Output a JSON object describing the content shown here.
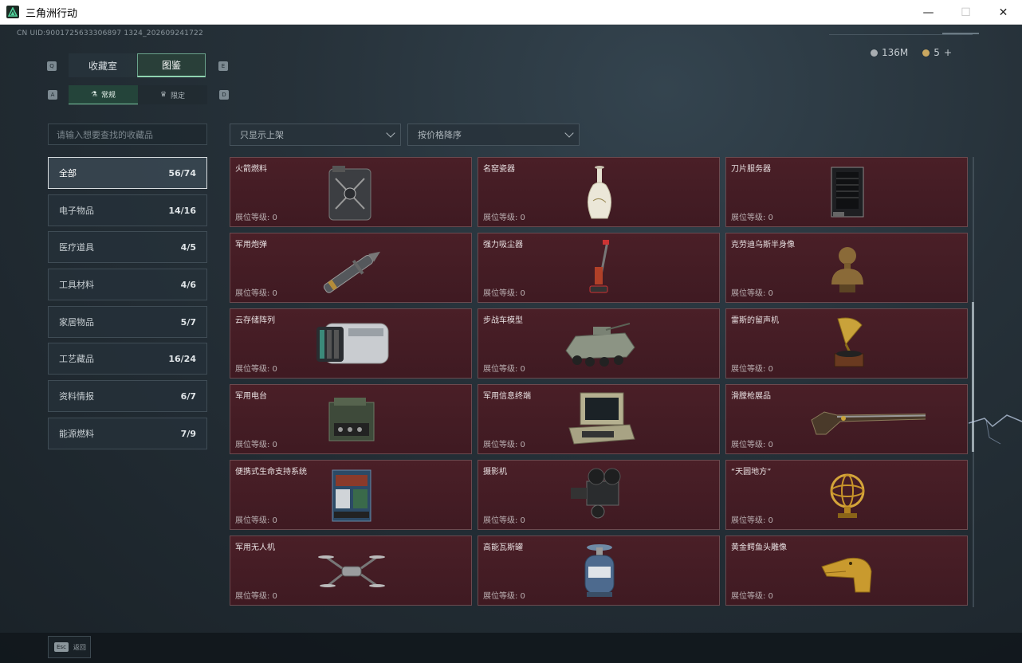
{
  "window": {
    "title": "三角洲行动",
    "minimize": "—",
    "maximize": "☐",
    "close": "✕"
  },
  "header": {
    "uid": "CN UID:9001725633306897 1324_202609241722",
    "currency_a": "136M",
    "currency_b": "5",
    "currency_add": "+"
  },
  "tabs": {
    "left_key": "Q",
    "right_key": "E",
    "primary": [
      {
        "label": "收藏室"
      },
      {
        "label": "图鉴"
      }
    ],
    "sub_left_key": "A",
    "sub_right_key": "D",
    "secondary": [
      {
        "label": "常规",
        "icon": "flask-icon"
      },
      {
        "label": "限定",
        "icon": "crown-icon"
      }
    ]
  },
  "search": {
    "placeholder": "请输入想要查找的收藏品"
  },
  "filters": {
    "display": "只显示上架",
    "sort": "按价格降序"
  },
  "categories": [
    {
      "label": "全部",
      "count": "56/74"
    },
    {
      "label": "电子物品",
      "count": "14/16"
    },
    {
      "label": "医疗道具",
      "count": "4/5"
    },
    {
      "label": "工具材料",
      "count": "4/6"
    },
    {
      "label": "家居物品",
      "count": "5/7"
    },
    {
      "label": "工艺藏品",
      "count": "16/24"
    },
    {
      "label": "资料情报",
      "count": "6/7"
    },
    {
      "label": "能源燃料",
      "count": "7/9"
    }
  ],
  "items": [
    {
      "name": "火箭燃料",
      "level": "展位等级: 0",
      "icon": "fuel-jerrycan-icon"
    },
    {
      "name": "名窑瓷器",
      "level": "展位等级: 0",
      "icon": "porcelain-vase-icon"
    },
    {
      "name": "刀片服务器",
      "level": "展位等级: 0",
      "icon": "blade-server-icon"
    },
    {
      "name": "军用炮弹",
      "level": "展位等级: 0",
      "icon": "artillery-shell-icon"
    },
    {
      "name": "强力吸尘器",
      "level": "展位等级: 0",
      "icon": "vacuum-cleaner-icon"
    },
    {
      "name": "克劳迪乌斯半身像",
      "level": "展位等级: 0",
      "icon": "bust-statue-icon"
    },
    {
      "name": "云存储阵列",
      "level": "展位等级: 0",
      "icon": "storage-array-icon"
    },
    {
      "name": "步战车模型",
      "level": "展位等级: 0",
      "icon": "ifv-model-icon"
    },
    {
      "name": "雷斯的留声机",
      "level": "展位等级: 0",
      "icon": "gramophone-icon"
    },
    {
      "name": "军用电台",
      "level": "展位等级: 0",
      "icon": "military-radio-icon"
    },
    {
      "name": "军用信息终端",
      "level": "展位等级: 0",
      "icon": "rugged-terminal-icon"
    },
    {
      "name": "滑膛枪展品",
      "level": "展位等级: 0",
      "icon": "musket-icon"
    },
    {
      "name": "便携式生命支持系统",
      "level": "展位等级: 0",
      "icon": "life-support-icon"
    },
    {
      "name": "摄影机",
      "level": "展位等级: 0",
      "icon": "film-camera-icon"
    },
    {
      "name": "“天圆地方”",
      "level": "展位等级: 0",
      "icon": "armillary-sphere-icon"
    },
    {
      "name": "军用无人机",
      "level": "展位等级: 0",
      "icon": "drone-icon"
    },
    {
      "name": "高能瓦斯罐",
      "level": "展位等级: 0",
      "icon": "gas-canister-icon"
    },
    {
      "name": "黄金鳄鱼头雕像",
      "level": "展位等级: 0",
      "icon": "golden-crocodile-icon"
    }
  ],
  "footer": {
    "esc_key": "Esc",
    "back_label": "返回"
  }
}
